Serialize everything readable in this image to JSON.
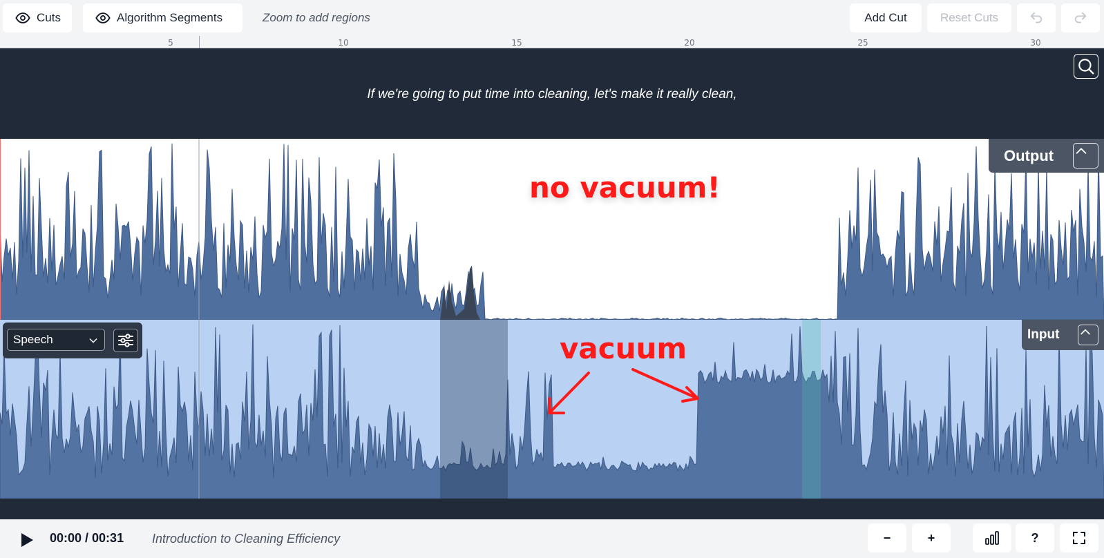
{
  "toolbar": {
    "cuts_label": "Cuts",
    "algorithm_segments_label": "Algorithm Segments",
    "zoom_hint": "Zoom to add regions",
    "add_cut_label": "Add Cut",
    "reset_cuts_label": "Reset Cuts",
    "undo_icon": "undo-icon",
    "redo_icon": "redo-icon"
  },
  "ruler": {
    "ticks": [
      "5",
      "10",
      "15",
      "20",
      "25",
      "30"
    ]
  },
  "caption": {
    "text": "If we're going to put time into cleaning, let's make it really clean,"
  },
  "output_track": {
    "label": "Output",
    "annotation": "no vacuum!"
  },
  "input_track": {
    "label": "Input",
    "mode_select": "Speech",
    "annotation": "vacuum"
  },
  "playback": {
    "timecode": "00:00 / 00:31",
    "title": "Introduction to Cleaning Efficiency",
    "zoom_out_label": "−",
    "zoom_in_label": "+",
    "help_label": "?"
  },
  "colors": {
    "waveform": "#4f6f9f",
    "waveform_dark": "#3a5079",
    "caption_bg": "#212a38",
    "input_bg": "#b9d1f3",
    "annotation": "#ff1a1a"
  }
}
